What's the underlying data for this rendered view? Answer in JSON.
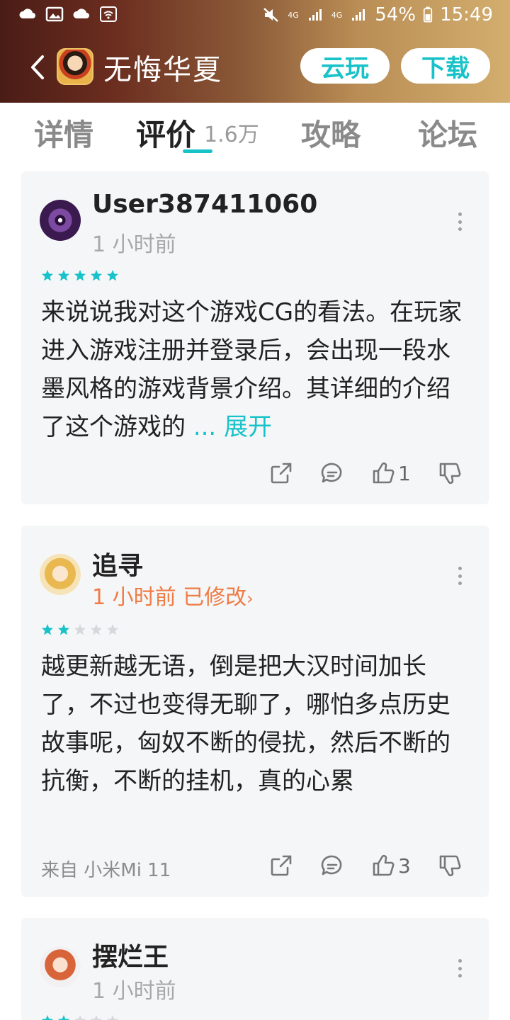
{
  "status_bar": {
    "network_4g_a": "4G",
    "network_4g_b": "4G",
    "battery": "54%",
    "time": "15:49"
  },
  "toolbar": {
    "title": "无悔华夏",
    "cloud_play": "云玩",
    "download": "下载"
  },
  "tabs": [
    {
      "label": "详情"
    },
    {
      "label": "评价",
      "count": "1.6万"
    },
    {
      "label": "攻略"
    },
    {
      "label": "论坛"
    }
  ],
  "reviews": [
    {
      "user": "User387411060",
      "time": "1 小时前",
      "edited": "",
      "rating": 5,
      "text": "来说说我对这个游戏CG的看法。在玩家进入游戏注册并登录后，会出现一段水墨风格的游戏背景介绍。其详细的介绍了这个游戏的",
      "ellipsis": "...",
      "expand": "展开",
      "device": "",
      "likes": "1"
    },
    {
      "user": "追寻",
      "time": "1 小时前",
      "edited": "已修改",
      "rating": 2,
      "text": "越更新越无语，倒是把大汉时间加长了，不过也变得无聊了，哪怕多点历史故事呢，匈奴不断的侵扰，然后不断的抗衡，不断的挂机，真的心累",
      "device": "来自 小米Mi 11",
      "likes": "3"
    },
    {
      "user": "摆烂王",
      "time": "1 小时前",
      "rating": 2
    }
  ],
  "colors": {
    "accent": "#17c2c8",
    "edited": "#f07b43",
    "star_empty": "#d6d8dc"
  }
}
